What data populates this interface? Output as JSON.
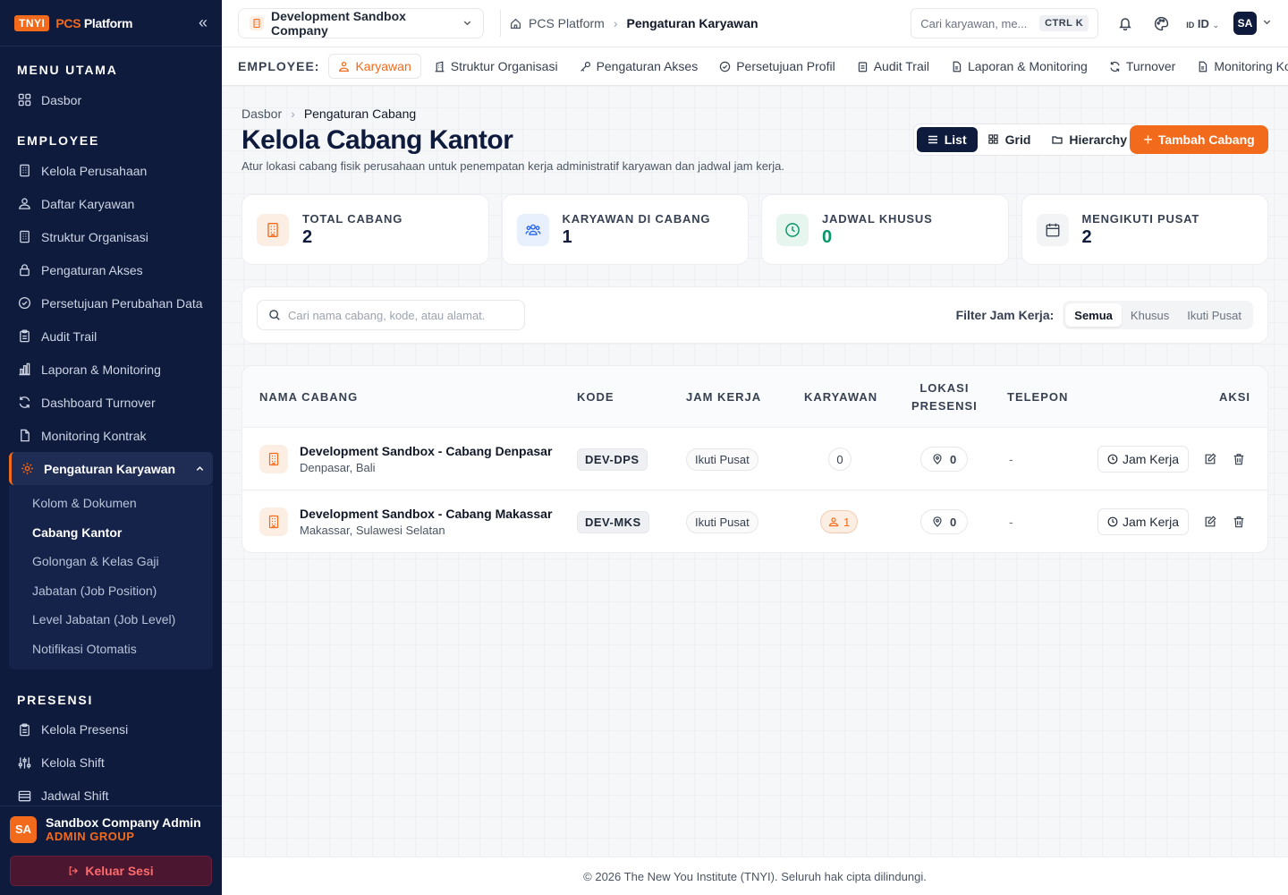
{
  "brand": {
    "badge": "TNYI",
    "name_accent": "PCS",
    "name_rest": " Platform"
  },
  "sidebar": {
    "sections": {
      "main": "MENU UTAMA",
      "employee": "EMPLOYEE",
      "presensi": "PRESENSI"
    },
    "main_items": [
      {
        "label": "Dasbor",
        "icon": "grid-icon"
      }
    ],
    "employee_items": [
      {
        "label": "Kelola Perusahaan",
        "icon": "building-icon"
      },
      {
        "label": "Daftar Karyawan",
        "icon": "users-icon"
      },
      {
        "label": "Struktur Organisasi",
        "icon": "building-icon"
      },
      {
        "label": "Pengaturan Akses",
        "icon": "lock-icon"
      },
      {
        "label": "Persetujuan Perubahan Data",
        "icon": "check-circle-icon"
      },
      {
        "label": "Audit Trail",
        "icon": "clipboard-icon"
      },
      {
        "label": "Laporan & Monitoring",
        "icon": "chart-icon"
      },
      {
        "label": "Dashboard Turnover",
        "icon": "refresh-icon"
      },
      {
        "label": "Monitoring Kontrak",
        "icon": "file-icon"
      }
    ],
    "active_item": {
      "label": "Pengaturan Karyawan",
      "icon": "gear-icon"
    },
    "sub_items": [
      "Kolom & Dokumen",
      "Cabang Kantor",
      "Golongan & Kelas Gaji",
      "Jabatan (Job Position)",
      "Level Jabatan (Job Level)",
      "Notifikasi Otomatis"
    ],
    "current_sub": "Cabang Kantor",
    "presensi_items": [
      {
        "label": "Kelola Presensi",
        "icon": "clipboard-icon"
      },
      {
        "label": "Kelola Shift",
        "icon": "sliders-icon"
      },
      {
        "label": "Jadwal Shift",
        "icon": "table-icon"
      }
    ],
    "user": {
      "initials": "SA",
      "name": "Sandbox Company Admin",
      "role": "ADMIN GROUP"
    },
    "logout_label": "Keluar Sesi"
  },
  "topbar": {
    "company": "Development Sandbox Company",
    "breadcrumb": [
      "PCS Platform",
      "Pengaturan Karyawan"
    ],
    "search_placeholder": "Cari karyawan, me...",
    "shortcut": "CTRL K",
    "lang": "ID",
    "lang_code": "ID",
    "user_initials": "SA"
  },
  "module_tabs": {
    "label": "EMPLOYEE:",
    "tabs": [
      {
        "label": "Karyawan",
        "icon": "users-icon",
        "active": true
      },
      {
        "label": "Struktur Organisasi",
        "icon": "building-icon"
      },
      {
        "label": "Pengaturan Akses",
        "icon": "key-icon"
      },
      {
        "label": "Persetujuan Profil",
        "icon": "check-circle-icon"
      },
      {
        "label": "Audit Trail",
        "icon": "clipboard-icon"
      },
      {
        "label": "Laporan & Monitoring",
        "icon": "file-icon"
      },
      {
        "label": "Turnover",
        "icon": "refresh-icon"
      },
      {
        "label": "Monitoring Ko",
        "icon": "file-icon"
      }
    ]
  },
  "page": {
    "breadcrumb": [
      "Dasbor",
      "Pengaturan Cabang"
    ],
    "title": "Kelola Cabang Kantor",
    "description": "Atur lokasi cabang fisik perusahaan untuk penempatan kerja administratif karyawan dan jadwal jam kerja.",
    "views": [
      "List",
      "Grid",
      "Hierarchy"
    ],
    "active_view": "List",
    "add_label": "Tambah Cabang"
  },
  "stats": [
    {
      "label": "TOTAL CABANG",
      "value": "2",
      "icon": "building-icon",
      "color": "#f26b1d"
    },
    {
      "label": "KARYAWAN DI CABANG",
      "value": "1",
      "icon": "users-icon",
      "color": "#2563eb"
    },
    {
      "label": "JADWAL KHUSUS",
      "value": "0",
      "icon": "clock-icon",
      "color": "#059669"
    },
    {
      "label": "MENGIKUTI PUSAT",
      "value": "2",
      "icon": "calendar-icon",
      "color": "#374151"
    }
  ],
  "filter": {
    "search_placeholder": "Cari nama cabang, kode, atau alamat.",
    "label": "Filter Jam Kerja:",
    "options": [
      "Semua",
      "Khusus",
      "Ikuti Pusat"
    ],
    "active": "Semua"
  },
  "table": {
    "columns": [
      "NAMA CABANG",
      "KODE",
      "JAM KERJA",
      "KARYAWAN",
      "LOKASI\nPRESENSI",
      "TELEPON",
      "AKSI"
    ],
    "columns_loc": [
      "LOKASI",
      "PRESENSI"
    ],
    "rows": [
      {
        "name": "Development Sandbox - Cabang Denpasar",
        "city": "Denpasar, Bali",
        "code": "DEV-DPS",
        "schedule": "Ikuti Pusat",
        "employees": "0",
        "locations": "0",
        "phone": "-",
        "action": "Jam Kerja"
      },
      {
        "name": "Development Sandbox - Cabang Makassar",
        "city": "Makassar, Sulawesi Selatan",
        "code": "DEV-MKS",
        "schedule": "Ikuti Pusat",
        "employees": "1",
        "locations": "0",
        "phone": "-",
        "action": "Jam Kerja"
      }
    ]
  },
  "footer": {
    "text": "© 2026 The New You Institute (TNYI). Seluruh hak cipta dilindungi."
  },
  "colors": {
    "accent": "#f26b1d",
    "sidebar_bg": "#0f1b3d"
  }
}
